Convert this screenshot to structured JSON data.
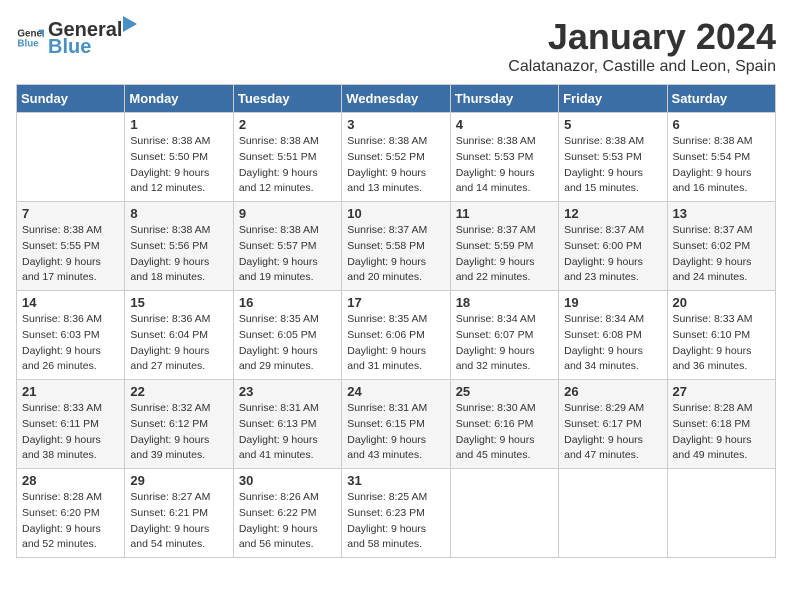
{
  "logo": {
    "general": "General",
    "blue": "Blue"
  },
  "title": "January 2024",
  "subtitle": "Calatanazor, Castille and Leon, Spain",
  "columns": [
    "Sunday",
    "Monday",
    "Tuesday",
    "Wednesday",
    "Thursday",
    "Friday",
    "Saturday"
  ],
  "weeks": [
    [
      {
        "day": "",
        "content": ""
      },
      {
        "day": "1",
        "content": "Sunrise: 8:38 AM\nSunset: 5:50 PM\nDaylight: 9 hours\nand 12 minutes."
      },
      {
        "day": "2",
        "content": "Sunrise: 8:38 AM\nSunset: 5:51 PM\nDaylight: 9 hours\nand 12 minutes."
      },
      {
        "day": "3",
        "content": "Sunrise: 8:38 AM\nSunset: 5:52 PM\nDaylight: 9 hours\nand 13 minutes."
      },
      {
        "day": "4",
        "content": "Sunrise: 8:38 AM\nSunset: 5:53 PM\nDaylight: 9 hours\nand 14 minutes."
      },
      {
        "day": "5",
        "content": "Sunrise: 8:38 AM\nSunset: 5:53 PM\nDaylight: 9 hours\nand 15 minutes."
      },
      {
        "day": "6",
        "content": "Sunrise: 8:38 AM\nSunset: 5:54 PM\nDaylight: 9 hours\nand 16 minutes."
      }
    ],
    [
      {
        "day": "7",
        "content": "Sunrise: 8:38 AM\nSunset: 5:55 PM\nDaylight: 9 hours\nand 17 minutes."
      },
      {
        "day": "8",
        "content": "Sunrise: 8:38 AM\nSunset: 5:56 PM\nDaylight: 9 hours\nand 18 minutes."
      },
      {
        "day": "9",
        "content": "Sunrise: 8:38 AM\nSunset: 5:57 PM\nDaylight: 9 hours\nand 19 minutes."
      },
      {
        "day": "10",
        "content": "Sunrise: 8:37 AM\nSunset: 5:58 PM\nDaylight: 9 hours\nand 20 minutes."
      },
      {
        "day": "11",
        "content": "Sunrise: 8:37 AM\nSunset: 5:59 PM\nDaylight: 9 hours\nand 22 minutes."
      },
      {
        "day": "12",
        "content": "Sunrise: 8:37 AM\nSunset: 6:00 PM\nDaylight: 9 hours\nand 23 minutes."
      },
      {
        "day": "13",
        "content": "Sunrise: 8:37 AM\nSunset: 6:02 PM\nDaylight: 9 hours\nand 24 minutes."
      }
    ],
    [
      {
        "day": "14",
        "content": "Sunrise: 8:36 AM\nSunset: 6:03 PM\nDaylight: 9 hours\nand 26 minutes."
      },
      {
        "day": "15",
        "content": "Sunrise: 8:36 AM\nSunset: 6:04 PM\nDaylight: 9 hours\nand 27 minutes."
      },
      {
        "day": "16",
        "content": "Sunrise: 8:35 AM\nSunset: 6:05 PM\nDaylight: 9 hours\nand 29 minutes."
      },
      {
        "day": "17",
        "content": "Sunrise: 8:35 AM\nSunset: 6:06 PM\nDaylight: 9 hours\nand 31 minutes."
      },
      {
        "day": "18",
        "content": "Sunrise: 8:34 AM\nSunset: 6:07 PM\nDaylight: 9 hours\nand 32 minutes."
      },
      {
        "day": "19",
        "content": "Sunrise: 8:34 AM\nSunset: 6:08 PM\nDaylight: 9 hours\nand 34 minutes."
      },
      {
        "day": "20",
        "content": "Sunrise: 8:33 AM\nSunset: 6:10 PM\nDaylight: 9 hours\nand 36 minutes."
      }
    ],
    [
      {
        "day": "21",
        "content": "Sunrise: 8:33 AM\nSunset: 6:11 PM\nDaylight: 9 hours\nand 38 minutes."
      },
      {
        "day": "22",
        "content": "Sunrise: 8:32 AM\nSunset: 6:12 PM\nDaylight: 9 hours\nand 39 minutes."
      },
      {
        "day": "23",
        "content": "Sunrise: 8:31 AM\nSunset: 6:13 PM\nDaylight: 9 hours\nand 41 minutes."
      },
      {
        "day": "24",
        "content": "Sunrise: 8:31 AM\nSunset: 6:15 PM\nDaylight: 9 hours\nand 43 minutes."
      },
      {
        "day": "25",
        "content": "Sunrise: 8:30 AM\nSunset: 6:16 PM\nDaylight: 9 hours\nand 45 minutes."
      },
      {
        "day": "26",
        "content": "Sunrise: 8:29 AM\nSunset: 6:17 PM\nDaylight: 9 hours\nand 47 minutes."
      },
      {
        "day": "27",
        "content": "Sunrise: 8:28 AM\nSunset: 6:18 PM\nDaylight: 9 hours\nand 49 minutes."
      }
    ],
    [
      {
        "day": "28",
        "content": "Sunrise: 8:28 AM\nSunset: 6:20 PM\nDaylight: 9 hours\nand 52 minutes."
      },
      {
        "day": "29",
        "content": "Sunrise: 8:27 AM\nSunset: 6:21 PM\nDaylight: 9 hours\nand 54 minutes."
      },
      {
        "day": "30",
        "content": "Sunrise: 8:26 AM\nSunset: 6:22 PM\nDaylight: 9 hours\nand 56 minutes."
      },
      {
        "day": "31",
        "content": "Sunrise: 8:25 AM\nSunset: 6:23 PM\nDaylight: 9 hours\nand 58 minutes."
      },
      {
        "day": "",
        "content": ""
      },
      {
        "day": "",
        "content": ""
      },
      {
        "day": "",
        "content": ""
      }
    ]
  ]
}
